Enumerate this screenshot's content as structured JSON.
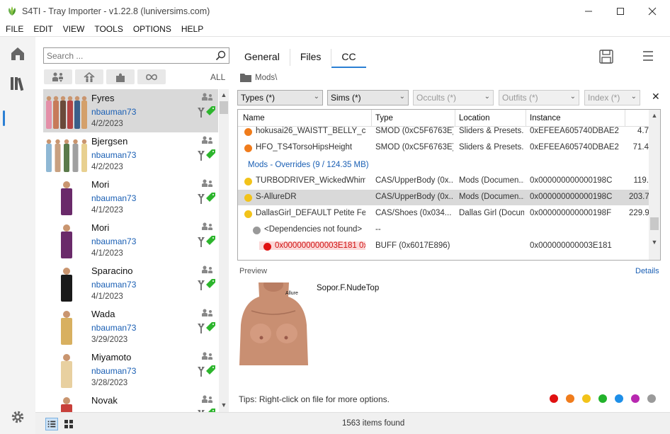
{
  "window": {
    "title": "S4TI - Tray Importer - v1.22.8 (luniversims.com)"
  },
  "menu": [
    "FILE",
    "EDIT",
    "VIEW",
    "TOOLS",
    "OPTIONS",
    "HELP"
  ],
  "search": {
    "placeholder": "Search ..."
  },
  "filters": {
    "all_label": "ALL"
  },
  "sims": [
    {
      "name": "Fyres",
      "user": "nbauman73",
      "date": "4/2/2023",
      "selected": true
    },
    {
      "name": "Bjergsen",
      "user": "nbauman73",
      "date": "4/2/2023",
      "selected": false
    },
    {
      "name": "Mori",
      "user": "nbauman73",
      "date": "4/1/2023",
      "selected": false
    },
    {
      "name": "Mori",
      "user": "nbauman73",
      "date": "4/1/2023",
      "selected": false
    },
    {
      "name": "Sparacino",
      "user": "nbauman73",
      "date": "4/1/2023",
      "selected": false
    },
    {
      "name": "Wada",
      "user": "nbauman73",
      "date": "3/29/2023",
      "selected": false
    },
    {
      "name": "Miyamoto",
      "user": "nbauman73",
      "date": "3/28/2023",
      "selected": false
    },
    {
      "name": "Novak",
      "user": "",
      "date": "",
      "selected": false
    }
  ],
  "status": {
    "items_found": "1563 items found"
  },
  "tabs": [
    {
      "label": "General",
      "selected": false
    },
    {
      "label": "Files",
      "selected": false
    },
    {
      "label": "CC",
      "selected": true
    }
  ],
  "breadcrumb": {
    "path": "Mods\\"
  },
  "dropdowns": {
    "types": "Types (*)",
    "sims": "Sims (*)",
    "occults": "Occults (*)",
    "outfits": "Outfits (*)",
    "index": "Index (*)"
  },
  "grid": {
    "columns": [
      "Name",
      "Type",
      "Location",
      "Instance"
    ],
    "group_header": "Mods - Overrides  (9 / 124.35 MB)",
    "rows_top": [
      {
        "name": "hokusai26_WAISTT_BELLY_cus...",
        "type": "SMOD (0xC5F6763E)",
        "location": "Sliders & Presets...",
        "instance": "0xEFEEA605740DBAE2",
        "size": "4.7",
        "dot": "#f07c1c"
      },
      {
        "name": "HFO_TS4TorsoHipsHeight",
        "type": "SMOD (0xC5F6763E)",
        "location": "Sliders & Presets...",
        "instance": "0xEFEEA605740DBAE2",
        "size": "71.4",
        "dot": "#f07c1c"
      }
    ],
    "rows_bottom": [
      {
        "name": "TURBODRIVER_WickedWhim...",
        "type": "CAS/UpperBody (0x...",
        "location": "Mods (Documen...",
        "instance": "0x000000000000198C",
        "size": "119.",
        "dot": "#f2c31a",
        "selected": false
      },
      {
        "name": "S-AllureDR",
        "type": "CAS/UpperBody (0x...",
        "location": "Mods (Documen...",
        "instance": "0x000000000000198C",
        "size": "203.7",
        "dot": "#f2c31a",
        "selected": true
      },
      {
        "name": "DallasGirl_DEFAULT Petite Fee...",
        "type": "CAS/Shoes (0x034...",
        "location": "Dallas Girl (Docum...",
        "instance": "0x000000000000198F",
        "size": "229.9",
        "dot": "#f2c31a",
        "selected": false
      }
    ],
    "dependency_row": {
      "name": "<Dependencies not found>",
      "type": "--",
      "dot": "#999999"
    },
    "missing_row": {
      "name": "0x000000000003E181 0x...",
      "type": "BUFF (0x6017E896)",
      "instance": "0x000000000003E181",
      "dot": "#e01010"
    }
  },
  "preview": {
    "label": "Preview",
    "details": "Details",
    "overlay_text": "Allure",
    "cc_name": "Sopor.F.NudeTop"
  },
  "tips": {
    "text": "Tips:  Right-click on file for more options."
  },
  "color_dots": [
    "#e01010",
    "#f07c1c",
    "#f2c31a",
    "#22b22b",
    "#1e8fe8",
    "#b828b0",
    "#9a9a9a"
  ]
}
